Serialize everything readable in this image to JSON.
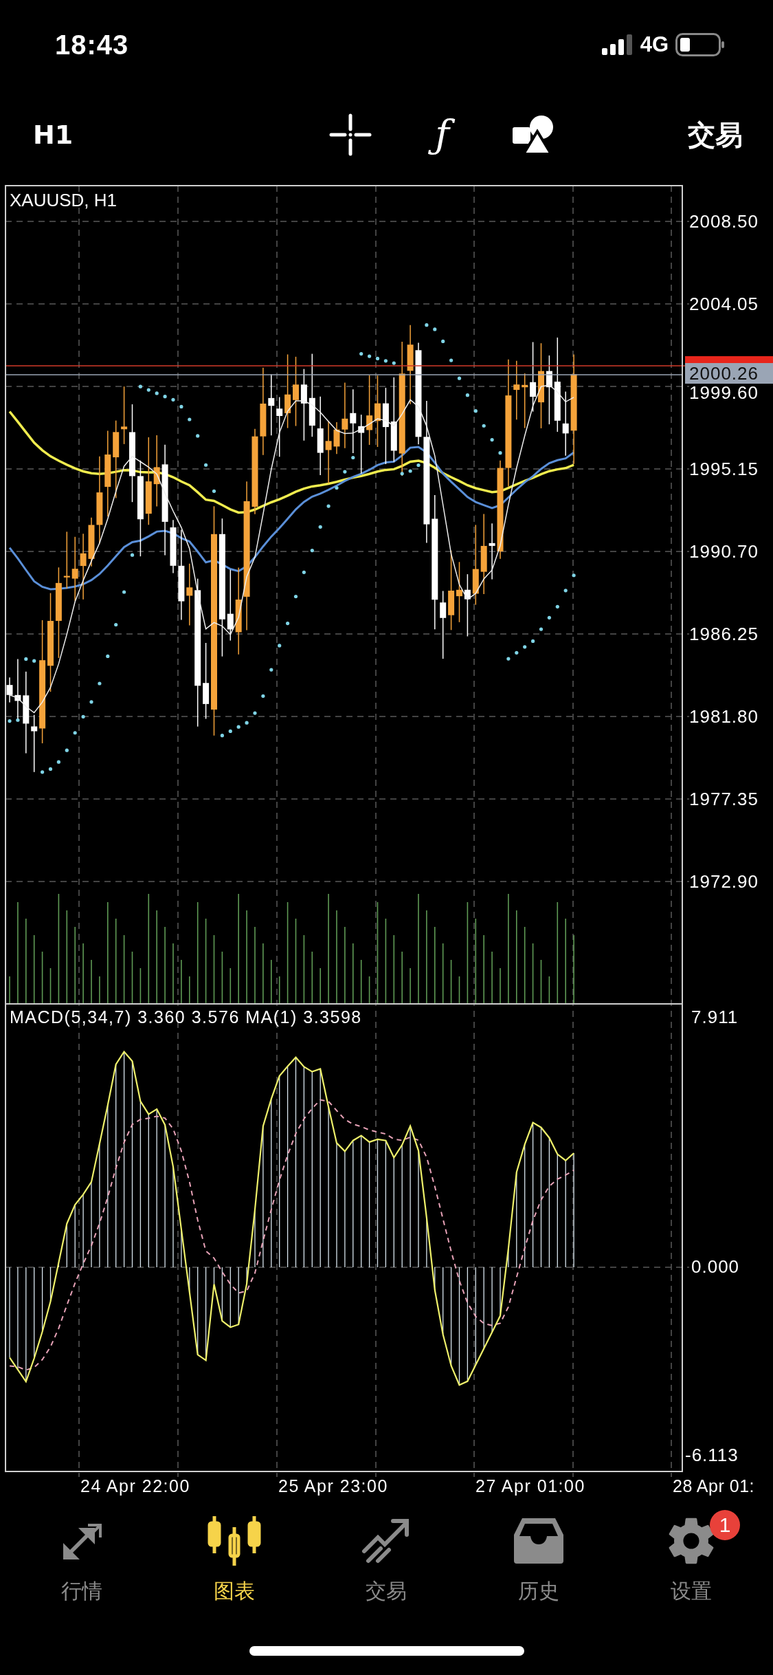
{
  "status_bar": {
    "time": "18:43",
    "network": "4G"
  },
  "toolbar": {
    "timeframe": "H1",
    "function_icon": "ƒ",
    "trade_label": "交易"
  },
  "chart": {
    "symbol": "XAUUSD, H1",
    "price_labels": [
      "2008.50",
      "2004.05",
      "1999.60",
      "1995.15",
      "1990.70",
      "1986.25",
      "1981.80",
      "1977.35",
      "1972.90"
    ],
    "current_price": "2000.26",
    "macd": {
      "label": "MACD(5,34,7) 3.360 3.576 MA(1) 3.3598",
      "scale_labels": [
        "7.911",
        "0.000",
        "-6.113"
      ]
    },
    "time_labels": [
      "24 Apr 22:00",
      "25 Apr 23:00",
      "27 Apr 01:00",
      "28 Apr 01:"
    ]
  },
  "tabs": [
    {
      "label": "行情",
      "selected": false
    },
    {
      "label": "图表",
      "selected": true
    },
    {
      "label": "交易",
      "selected": false
    },
    {
      "label": "历史",
      "selected": false
    },
    {
      "label": "设置",
      "selected": false,
      "badge": "1"
    }
  ]
}
